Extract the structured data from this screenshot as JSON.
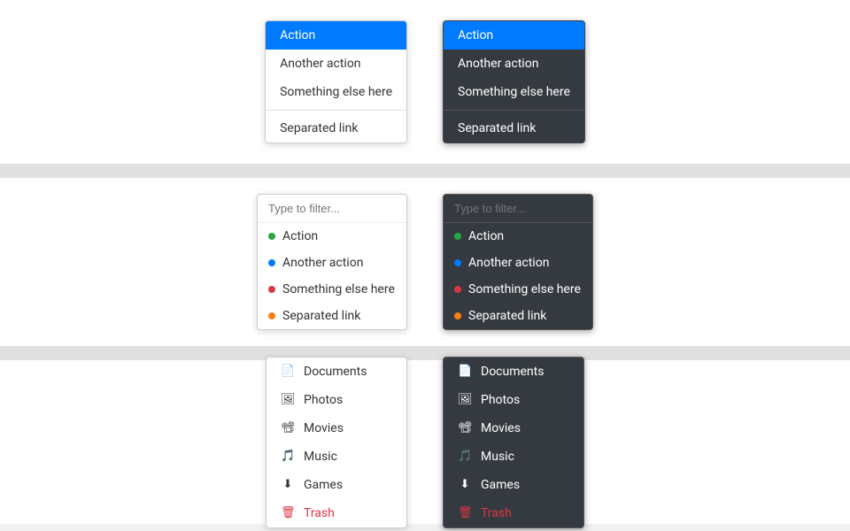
{
  "section1": {
    "light_dropdown": {
      "items": [
        {
          "label": "Action",
          "active": true
        },
        {
          "label": "Another action",
          "active": false
        },
        {
          "label": "Something else here",
          "active": false
        },
        {
          "divider": true
        },
        {
          "label": "Separated link",
          "active": false
        }
      ]
    },
    "dark_dropdown": {
      "items": [
        {
          "label": "Action",
          "active": true
        },
        {
          "label": "Another action",
          "active": false
        },
        {
          "label": "Something else here",
          "active": false
        },
        {
          "divider": true
        },
        {
          "label": "Separated link",
          "active": false
        }
      ]
    }
  },
  "section2": {
    "filter_placeholder": "Type to filter...",
    "light_filter": {
      "items": [
        {
          "label": "Action",
          "dot": "green"
        },
        {
          "label": "Another action",
          "dot": "blue"
        },
        {
          "label": "Something else here",
          "dot": "red"
        },
        {
          "label": "Separated link",
          "dot": "orange"
        }
      ]
    },
    "dark_filter": {
      "items": [
        {
          "label": "Action",
          "dot": "green"
        },
        {
          "label": "Another action",
          "dot": "blue"
        },
        {
          "label": "Something else here",
          "dot": "red"
        },
        {
          "label": "Separated link",
          "dot": "orange"
        }
      ]
    }
  },
  "section3": {
    "light_icon": {
      "items": [
        {
          "label": "Documents",
          "icon": "📄",
          "danger": false
        },
        {
          "label": "Photos",
          "icon": "🖼",
          "danger": false
        },
        {
          "label": "Movies",
          "icon": "📽",
          "danger": false
        },
        {
          "label": "Music",
          "icon": "🎵",
          "danger": false
        },
        {
          "label": "Games",
          "icon": "⬇",
          "danger": false
        },
        {
          "label": "Trash",
          "icon": "🗑",
          "danger": true
        }
      ]
    },
    "dark_icon": {
      "items": [
        {
          "label": "Documents",
          "icon": "📄",
          "danger": false
        },
        {
          "label": "Photos",
          "icon": "🖼",
          "danger": false
        },
        {
          "label": "Movies",
          "icon": "📽",
          "danger": false
        },
        {
          "label": "Music",
          "icon": "🎵",
          "danger": false
        },
        {
          "label": "Games",
          "icon": "⬇",
          "danger": false
        },
        {
          "label": "Trash",
          "icon": "🗑",
          "danger": true
        }
      ]
    }
  }
}
